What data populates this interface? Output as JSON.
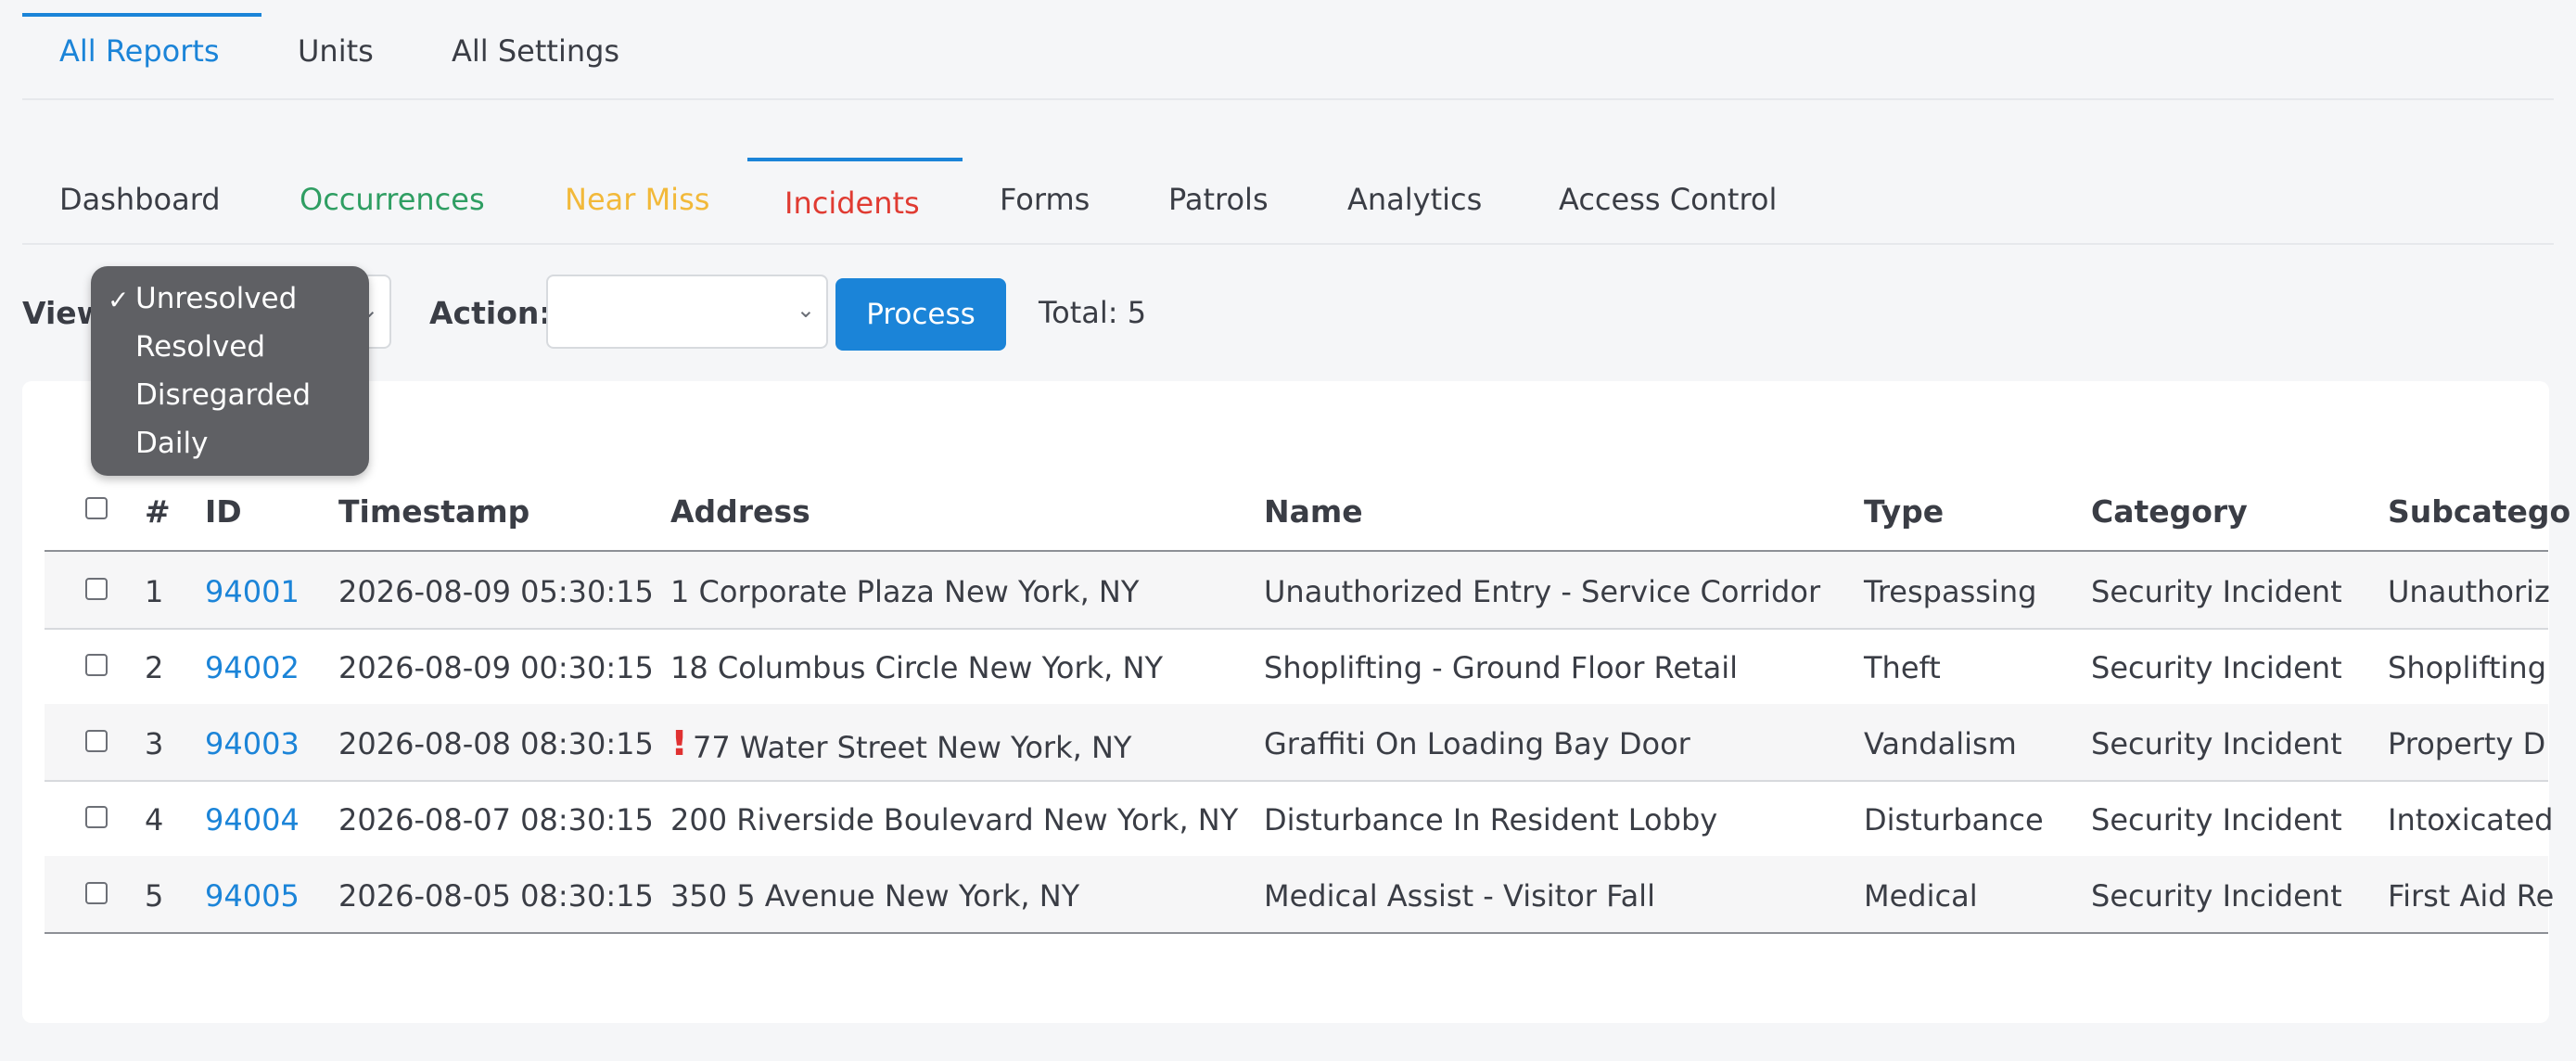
{
  "top_tabs": [
    "All Reports",
    "Units",
    "All Settings"
  ],
  "sub_tabs": [
    {
      "label": "Dashboard",
      "color": "#3a3d45"
    },
    {
      "label": "Occurrences",
      "color": "#2f9e63"
    },
    {
      "label": "Near Miss",
      "color": "#f2b93a"
    },
    {
      "label": "Incidents",
      "color": "#e03b32"
    },
    {
      "label": "Forms",
      "color": "#3a3d45"
    },
    {
      "label": "Patrols",
      "color": "#3a3d45"
    },
    {
      "label": "Analytics",
      "color": "#3a3d45"
    },
    {
      "label": "Access Control",
      "color": "#3a3d45"
    }
  ],
  "controls": {
    "view_label": "View",
    "view_options": [
      "Unresolved",
      "Resolved",
      "Disregarded",
      "Daily"
    ],
    "view_selected": "Unresolved",
    "action_label": "Action:",
    "action_value": "",
    "process_label": "Process",
    "total_text": "Total: 5"
  },
  "table": {
    "headers": [
      "#",
      "ID",
      "Timestamp",
      "Address",
      "Name",
      "Type",
      "Category",
      "Subcatego"
    ],
    "rows": [
      {
        "num": "1",
        "id": "94001",
        "timestamp": "2026-08-09 05:30:15",
        "flag": "",
        "address": "1 Corporate Plaza New York, NY",
        "name": "Unauthorized Entry - Service Corridor",
        "type": "Trespassing",
        "category": "Security Incident",
        "subcategory": "Unauthoriz"
      },
      {
        "num": "2",
        "id": "94002",
        "timestamp": "2026-08-09 00:30:15",
        "flag": "",
        "address": "18 Columbus Circle New York, NY",
        "name": "Shoplifting - Ground Floor Retail",
        "type": "Theft",
        "category": "Security Incident",
        "subcategory": "Shoplifting"
      },
      {
        "num": "3",
        "id": "94003",
        "timestamp": "2026-08-08 08:30:15",
        "flag": "!",
        "address": "77 Water Street New York, NY",
        "name": "Graffiti On Loading Bay Door",
        "type": "Vandalism",
        "category": "Security Incident",
        "subcategory": "Property D"
      },
      {
        "num": "4",
        "id": "94004",
        "timestamp": "2026-08-07 08:30:15",
        "flag": "",
        "address": "200 Riverside Boulevard New York, NY",
        "name": "Disturbance In Resident Lobby",
        "type": "Disturbance",
        "category": "Security Incident",
        "subcategory": "Intoxicated"
      },
      {
        "num": "5",
        "id": "94005",
        "timestamp": "2026-08-05 08:30:15",
        "flag": "",
        "address": "350 5 Avenue New York, NY",
        "name": "Medical Assist - Visitor Fall",
        "type": "Medical",
        "category": "Security Incident",
        "subcategory": "First Aid Re"
      }
    ]
  }
}
